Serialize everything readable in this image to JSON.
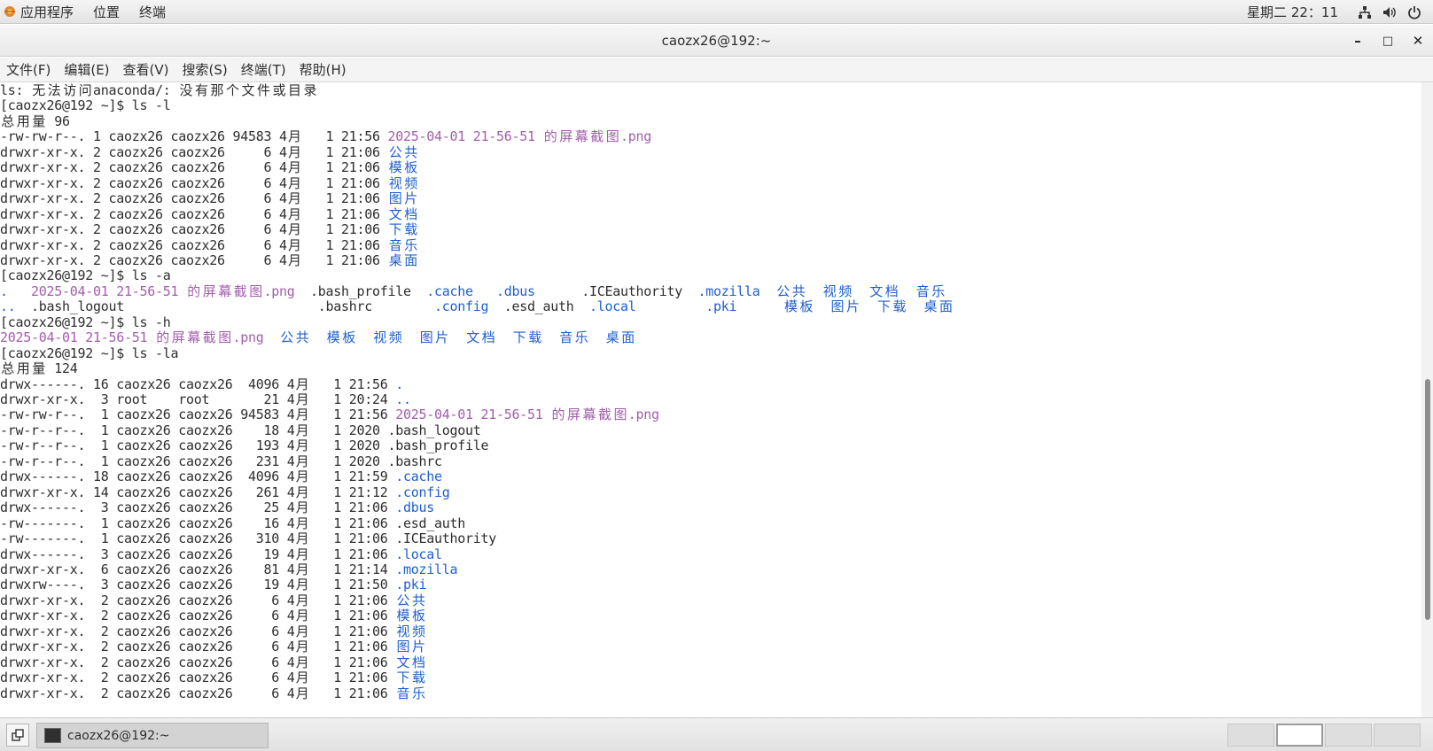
{
  "topbar": {
    "apps_label": "应用程序",
    "places_label": "位置",
    "terminal_label": "终端",
    "clock": "星期二 22：11"
  },
  "window": {
    "title": "caozx26@192:~",
    "minimize": "–",
    "maximize": "□",
    "close": "✕"
  },
  "menu": {
    "items": [
      "文件(F)",
      "编辑(E)",
      "查看(V)",
      "搜索(S)",
      "终端(T)",
      "帮助(H)"
    ]
  },
  "colors": {
    "directory": "#1f5fd1",
    "image_file": "#a35dad",
    "text": "#2e2e2e"
  },
  "terminal": {
    "lines": [
      [
        [
          "ls: 无法访问anaconda/: 没有那个文件或目录",
          "norm"
        ]
      ],
      [
        [
          "[caozx26@192 ~]$ ls -l",
          "norm"
        ]
      ],
      [
        [
          "总用量 96",
          "norm"
        ]
      ],
      [
        [
          "-rw-rw-r--. 1 caozx26 caozx26 94583 4月   1 21:56 ",
          "norm"
        ],
        [
          "2025-04-01 21-56-51 的屏幕截图.png",
          "img"
        ]
      ],
      [
        [
          "drwxr-xr-x. 2 caozx26 caozx26     6 4月   1 21:06 ",
          "norm"
        ],
        [
          "公共",
          "dir"
        ]
      ],
      [
        [
          "drwxr-xr-x. 2 caozx26 caozx26     6 4月   1 21:06 ",
          "norm"
        ],
        [
          "模板",
          "dir"
        ]
      ],
      [
        [
          "drwxr-xr-x. 2 caozx26 caozx26     6 4月   1 21:06 ",
          "norm"
        ],
        [
          "视频",
          "dir"
        ]
      ],
      [
        [
          "drwxr-xr-x. 2 caozx26 caozx26     6 4月   1 21:06 ",
          "norm"
        ],
        [
          "图片",
          "dir"
        ]
      ],
      [
        [
          "drwxr-xr-x. 2 caozx26 caozx26     6 4月   1 21:06 ",
          "norm"
        ],
        [
          "文档",
          "dir"
        ]
      ],
      [
        [
          "drwxr-xr-x. 2 caozx26 caozx26     6 4月   1 21:06 ",
          "norm"
        ],
        [
          "下载",
          "dir"
        ]
      ],
      [
        [
          "drwxr-xr-x. 2 caozx26 caozx26     6 4月   1 21:06 ",
          "norm"
        ],
        [
          "音乐",
          "dir"
        ]
      ],
      [
        [
          "drwxr-xr-x. 2 caozx26 caozx26     6 4月   1 21:06 ",
          "norm"
        ],
        [
          "桌面",
          "dir"
        ]
      ],
      [
        [
          "[caozx26@192 ~]$ ls -a",
          "norm"
        ]
      ],
      [
        [
          ".",
          "dir"
        ],
        [
          "   ",
          "norm"
        ],
        [
          "2025-04-01 21-56-51 的屏幕截图.png",
          "img"
        ],
        [
          "  .bash_profile  ",
          "norm"
        ],
        [
          ".cache",
          "dir"
        ],
        [
          "   ",
          "norm"
        ],
        [
          ".dbus",
          "dir"
        ],
        [
          "      .ICEauthority  ",
          "norm"
        ],
        [
          ".mozilla",
          "dir"
        ],
        [
          "  ",
          "norm"
        ],
        [
          "公共",
          "dir"
        ],
        [
          "  ",
          "norm"
        ],
        [
          "视频",
          "dir"
        ],
        [
          "  ",
          "norm"
        ],
        [
          "文档",
          "dir"
        ],
        [
          "  ",
          "norm"
        ],
        [
          "音乐",
          "dir"
        ]
      ],
      [
        [
          "..",
          "dir"
        ],
        [
          "  .bash_logout                         .bashrc        ",
          "norm"
        ],
        [
          ".config",
          "dir"
        ],
        [
          "  .esd_auth  ",
          "norm"
        ],
        [
          ".local",
          "dir"
        ],
        [
          "         ",
          "norm"
        ],
        [
          ".pki",
          "dir"
        ],
        [
          "      ",
          "norm"
        ],
        [
          "模板",
          "dir"
        ],
        [
          "  ",
          "norm"
        ],
        [
          "图片",
          "dir"
        ],
        [
          "  ",
          "norm"
        ],
        [
          "下载",
          "dir"
        ],
        [
          "  ",
          "norm"
        ],
        [
          "桌面",
          "dir"
        ]
      ],
      [
        [
          "[caozx26@192 ~]$ ls -h",
          "norm"
        ]
      ],
      [
        [
          "2025-04-01 21-56-51 的屏幕截图.png",
          "img"
        ],
        [
          "  ",
          "norm"
        ],
        [
          "公共",
          "dir"
        ],
        [
          "  ",
          "norm"
        ],
        [
          "模板",
          "dir"
        ],
        [
          "  ",
          "norm"
        ],
        [
          "视频",
          "dir"
        ],
        [
          "  ",
          "norm"
        ],
        [
          "图片",
          "dir"
        ],
        [
          "  ",
          "norm"
        ],
        [
          "文档",
          "dir"
        ],
        [
          "  ",
          "norm"
        ],
        [
          "下载",
          "dir"
        ],
        [
          "  ",
          "norm"
        ],
        [
          "音乐",
          "dir"
        ],
        [
          "  ",
          "norm"
        ],
        [
          "桌面",
          "dir"
        ]
      ],
      [
        [
          "[caozx26@192 ~]$ ls -la",
          "norm"
        ]
      ],
      [
        [
          "总用量 124",
          "norm"
        ]
      ],
      [
        [
          "drwx------. 16 caozx26 caozx26  4096 4月   1 21:56 ",
          "norm"
        ],
        [
          ".",
          "dir"
        ]
      ],
      [
        [
          "drwxr-xr-x.  3 root    root       21 4月   1 20:24 ",
          "norm"
        ],
        [
          "..",
          "dir"
        ]
      ],
      [
        [
          "-rw-rw-r--.  1 caozx26 caozx26 94583 4月   1 21:56 ",
          "norm"
        ],
        [
          "2025-04-01 21-56-51 的屏幕截图.png",
          "img"
        ]
      ],
      [
        [
          "-rw-r--r--.  1 caozx26 caozx26    18 4月   1 2020 .bash_logout",
          "norm"
        ]
      ],
      [
        [
          "-rw-r--r--.  1 caozx26 caozx26   193 4月   1 2020 .bash_profile",
          "norm"
        ]
      ],
      [
        [
          "-rw-r--r--.  1 caozx26 caozx26   231 4月   1 2020 .bashrc",
          "norm"
        ]
      ],
      [
        [
          "drwx------. 18 caozx26 caozx26  4096 4月   1 21:59 ",
          "norm"
        ],
        [
          ".cache",
          "dir"
        ]
      ],
      [
        [
          "drwxr-xr-x. 14 caozx26 caozx26   261 4月   1 21:12 ",
          "norm"
        ],
        [
          ".config",
          "dir"
        ]
      ],
      [
        [
          "drwx------.  3 caozx26 caozx26    25 4月   1 21:06 ",
          "norm"
        ],
        [
          ".dbus",
          "dir"
        ]
      ],
      [
        [
          "-rw-------.  1 caozx26 caozx26    16 4月   1 21:06 .esd_auth",
          "norm"
        ]
      ],
      [
        [
          "-rw-------.  1 caozx26 caozx26   310 4月   1 21:06 .ICEauthority",
          "norm"
        ]
      ],
      [
        [
          "drwx------.  3 caozx26 caozx26    19 4月   1 21:06 ",
          "norm"
        ],
        [
          ".local",
          "dir"
        ]
      ],
      [
        [
          "drwxr-xr-x.  6 caozx26 caozx26    81 4月   1 21:14 ",
          "norm"
        ],
        [
          ".mozilla",
          "dir"
        ]
      ],
      [
        [
          "drwxrw----.  3 caozx26 caozx26    19 4月   1 21:50 ",
          "norm"
        ],
        [
          ".pki",
          "dir"
        ]
      ],
      [
        [
          "drwxr-xr-x.  2 caozx26 caozx26     6 4月   1 21:06 ",
          "norm"
        ],
        [
          "公共",
          "dir"
        ]
      ],
      [
        [
          "drwxr-xr-x.  2 caozx26 caozx26     6 4月   1 21:06 ",
          "norm"
        ],
        [
          "模板",
          "dir"
        ]
      ],
      [
        [
          "drwxr-xr-x.  2 caozx26 caozx26     6 4月   1 21:06 ",
          "norm"
        ],
        [
          "视频",
          "dir"
        ]
      ],
      [
        [
          "drwxr-xr-x.  2 caozx26 caozx26     6 4月   1 21:06 ",
          "norm"
        ],
        [
          "图片",
          "dir"
        ]
      ],
      [
        [
          "drwxr-xr-x.  2 caozx26 caozx26     6 4月   1 21:06 ",
          "norm"
        ],
        [
          "文档",
          "dir"
        ]
      ],
      [
        [
          "drwxr-xr-x.  2 caozx26 caozx26     6 4月   1 21:06 ",
          "norm"
        ],
        [
          "下载",
          "dir"
        ]
      ],
      [
        [
          "drwxr-xr-x.  2 caozx26 caozx26     6 4月   1 21:06 ",
          "norm"
        ],
        [
          "音乐",
          "dir"
        ]
      ]
    ]
  },
  "taskbar": {
    "task_label": "caozx26@192:~",
    "workspaces": [
      {
        "active": false
      },
      {
        "active": true
      },
      {
        "active": false
      },
      {
        "active": false
      }
    ]
  }
}
